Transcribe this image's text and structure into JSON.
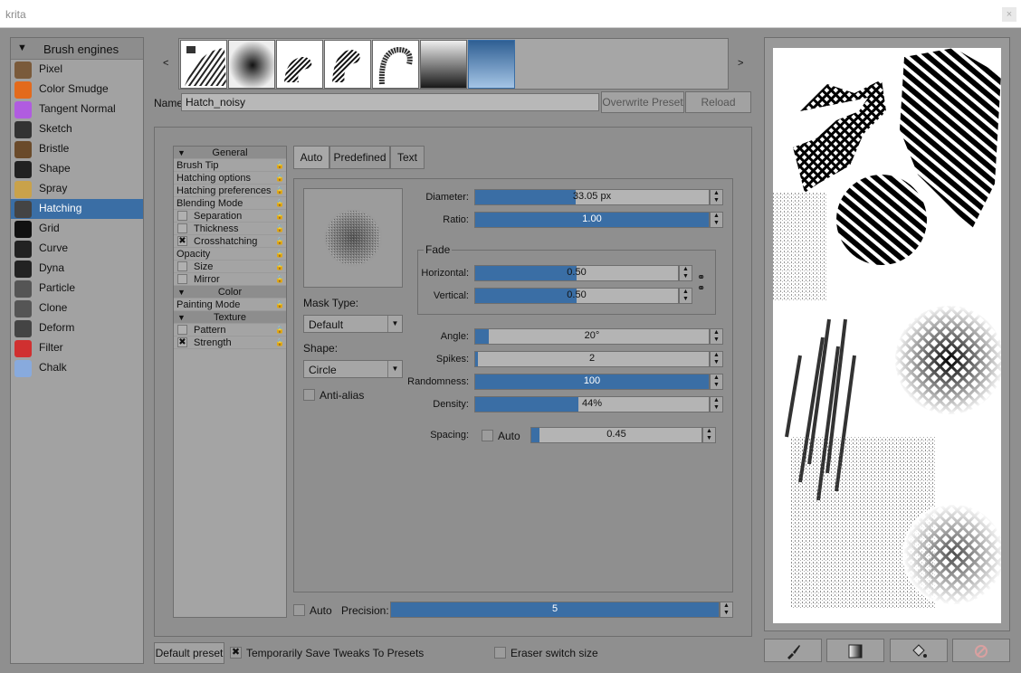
{
  "window": {
    "title": "krita",
    "close": "×"
  },
  "engines": {
    "header": "Brush engines",
    "items": [
      {
        "label": "Pixel",
        "icon": "pixel-brush-icon",
        "color": "#7a5a3a"
      },
      {
        "label": "Color Smudge",
        "icon": "color-smudge-icon",
        "color": "#e36a1c"
      },
      {
        "label": "Tangent Normal",
        "icon": "tangent-normal-icon",
        "color": "#b05ce0"
      },
      {
        "label": "Sketch",
        "icon": "sketch-icon",
        "color": "#333"
      },
      {
        "label": "Bristle",
        "icon": "bristle-icon",
        "color": "#6a4a2a"
      },
      {
        "label": "Shape",
        "icon": "shape-icon",
        "color": "#222"
      },
      {
        "label": "Spray",
        "icon": "spray-icon",
        "color": "#c9a24a"
      },
      {
        "label": "Hatching",
        "icon": "hatching-icon",
        "color": "#444"
      },
      {
        "label": "Grid",
        "icon": "grid-icon",
        "color": "#111"
      },
      {
        "label": "Curve",
        "icon": "curve-icon",
        "color": "#222"
      },
      {
        "label": "Dyna",
        "icon": "dyna-icon",
        "color": "#222"
      },
      {
        "label": "Particle",
        "icon": "particle-icon",
        "color": "#555"
      },
      {
        "label": "Clone",
        "icon": "clone-icon",
        "color": "#555"
      },
      {
        "label": "Deform",
        "icon": "deform-icon",
        "color": "#444"
      },
      {
        "label": "Filter",
        "icon": "filter-icon",
        "color": "#d03030"
      },
      {
        "label": "Chalk",
        "icon": "chalk-icon",
        "color": "#88aadd"
      }
    ],
    "selected": "Hatching"
  },
  "presets": {
    "prev": "<",
    "next": ">"
  },
  "name_label": "Name:",
  "preset_name": "Hatch_noisy",
  "overwrite_button": "Overwrite Preset",
  "reload_button": "Reload",
  "options": {
    "general": "General",
    "brush_tip": "Brush Tip",
    "hatching_options": "Hatching options",
    "hatching_preferences": "Hatching preferences",
    "blending_mode": "Blending Mode",
    "separation": "Separation",
    "thickness": "Thickness",
    "crosshatching": "Crosshatching",
    "opacity": "Opacity",
    "size": "Size",
    "mirror": "Mirror",
    "color": "Color",
    "painting_mode": "Painting Mode",
    "texture": "Texture",
    "pattern": "Pattern",
    "strength": "Strength",
    "check_mark": "✖"
  },
  "tabs": [
    "Auto",
    "Predefined",
    "Text"
  ],
  "mask_type_label": "Mask Type:",
  "mask_type_value": "Default",
  "shape_label": "Shape:",
  "shape_value": "Circle",
  "antialias_label": "Anti-alias",
  "params": {
    "diameter": {
      "label": "Diameter:",
      "value": "33.05 px",
      "fill": 0.43
    },
    "ratio": {
      "label": "Ratio:",
      "value": "1.00",
      "fill": 1.0
    },
    "fade_label": "Fade",
    "horizontal": {
      "label": "Horizontal:",
      "value": "0.50",
      "fill": 0.5
    },
    "vertical": {
      "label": "Vertical:",
      "value": "0.50",
      "fill": 0.5
    },
    "angle": {
      "label": "Angle:",
      "value": "20°",
      "fill": 0.06
    },
    "spikes": {
      "label": "Spikes:",
      "value": "2",
      "fill": 0.01
    },
    "randomness": {
      "label": "Randomness:",
      "value": "100",
      "fill": 1.0
    },
    "density": {
      "label": "Density:",
      "value": "44%",
      "fill": 0.44
    },
    "spacing": {
      "label": "Spacing:",
      "auto_label": "Auto",
      "value": "0.45",
      "fill": 0.05
    }
  },
  "precision": {
    "auto_label": "Auto",
    "label": "Precision:",
    "value": "5",
    "fill": 1.0
  },
  "bottom": {
    "default_preset": "Default preset",
    "temp_save": "Temporarily Save Tweaks To Presets",
    "eraser_switch": "Eraser switch size"
  },
  "toolbar": [
    {
      "name": "brush-tool-icon"
    },
    {
      "name": "gradient-fill-icon"
    },
    {
      "name": "bucket-fill-icon"
    },
    {
      "name": "clear-scratchpad-icon"
    }
  ],
  "colors": {
    "accent": "#3a6ea5",
    "panel": "#8f8f8f"
  }
}
